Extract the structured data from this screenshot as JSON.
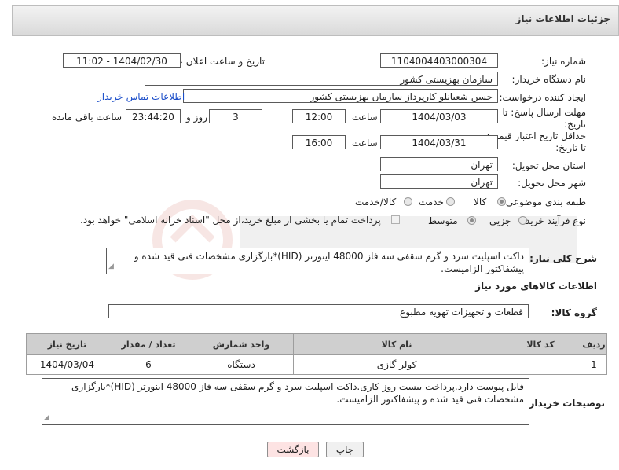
{
  "header": {
    "title": "جزئیات اطلاعات نیاز"
  },
  "fields": {
    "need_number_label": "شماره نیاز:",
    "need_number": "1104004403000304",
    "announce_label": "تاریخ و ساعت اعلان عمومی:",
    "announce_value": "1404/02/30 - 11:02",
    "buyer_org_label": "نام دستگاه خریدار:",
    "buyer_org": "سازمان بهزیستی کشور",
    "creator_label": "ایجاد کننده درخواست:",
    "creator": "حسن  شعبانلو کارپرداز سازمان بهزیستی کشور",
    "contact_link": "اطلاعات تماس خریدار",
    "deadline_label": "مهلت ارسال پاسخ: تا تاریخ:",
    "deadline_date": "1404/03/03",
    "time_label": "ساعت",
    "deadline_time": "12:00",
    "days_count": "3",
    "days_label": "روز و",
    "remaining_time": "23:44:20",
    "remaining_label": "ساعت باقی مانده",
    "validity_label": "حداقل تاریخ اعتبار قیمت: تا تاریخ:",
    "validity_date": "1404/03/31",
    "validity_time": "16:00",
    "province_label": "استان محل تحویل:",
    "province": "تهران",
    "city_label": "شهر محل تحویل:",
    "city": "تهران",
    "category_label": "طبقه بندی موضوعی:",
    "category_options": [
      "کالا",
      "خدمت",
      "کالا/خدمت"
    ],
    "category_selected": "کالا",
    "process_label": "نوع فرآیند خرید :",
    "process_options": [
      "جزیی",
      "متوسط"
    ],
    "payment_note": "پرداخت تمام یا بخشی از مبلغ خرید،از محل \"اسناد خزانه اسلامی\" خواهد بود.",
    "description_label": "شرح کلی نیاز:",
    "description": "داکت اسپلیت سرد و گرم سقفی  سه فاز  48000  اینورتر (HID)*بارگزاری مشخصات فنی قید شده و پیشفاکتور الزامیست.",
    "goods_info_title": "اطلاعات کالاهای مورد نیاز",
    "goods_group_label": "گروه کالا:",
    "goods_group": "قطعات و تجهیزات تهویه مطبوع"
  },
  "table": {
    "headers": [
      "ردیف",
      "کد کالا",
      "نام کالا",
      "واحد شمارش",
      "تعداد / مقدار",
      "تاریخ نیاز"
    ],
    "rows": [
      [
        "1",
        "--",
        "کولر گازی",
        "دستگاه",
        "6",
        "1404/03/04"
      ]
    ]
  },
  "buyer_notes": {
    "label": "توضیحات خریدار:",
    "text": "فایل پیوست دارد.پرداخت بیست روز کاری.داکت اسپلیت سرد و گرم سقفی  سه فاز  48000  اینورتر (HID)*بارگزاری مشخصات فنی قید شده و پیشفاکتور الزامیست."
  },
  "buttons": {
    "print": "چاپ",
    "back": "بازگشت"
  },
  "colors": {
    "back_button_bg": "#fde3e3",
    "link": "#1a4dc9"
  }
}
